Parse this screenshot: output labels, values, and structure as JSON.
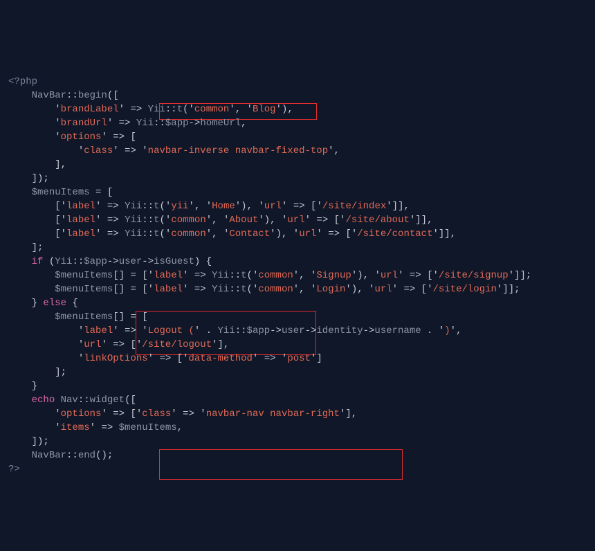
{
  "code": {
    "l1": "<?php",
    "l2a": "    NavBar::begin([",
    "l2b_key": "brandLabel",
    "l2b_yii": "Yii::t(",
    "l2b_s1": "common",
    "l2b_s2": "Blog",
    "l3_key": "brandUrl",
    "l3_rhs": "Yii::$app->homeUrl,",
    "l4_key": "options",
    "l5_key": "class",
    "l5_val": "navbar-inverse navbar-fixed-top",
    "l9": "    $menuItems = [",
    "mi1_label": "label",
    "mi1_s1": "yii",
    "mi1_s2": "Home",
    "mi1_url": "/site/index",
    "mi2_s1": "common",
    "mi2_s2": "About",
    "mi2_url": "/site/about",
    "mi3_s1": "common",
    "mi3_s2": "Contact",
    "mi3_url": "/site/contact",
    "if_cond": "Yii::$app->user->isGuest",
    "su_s1": "common",
    "su_s2": "Signup",
    "su_url": "/site/signup",
    "li_s1": "common",
    "li_s2": "Login",
    "li_url": "/site/login",
    "lo_pre": "Logout (",
    "lo_expr": "Yii::$app->user->identity->username",
    "lo_suf": ")",
    "lo_url": "/site/logout",
    "lo_dm": "data-method",
    "lo_dmv": "post",
    "nav_class": "navbar-nav navbar-right",
    "url_key": "url",
    "items_key": "items",
    "linkopt_key": "linkOptions"
  }
}
